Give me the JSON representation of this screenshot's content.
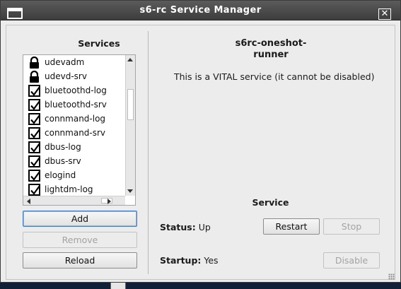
{
  "window": {
    "title": "s6-rc Service Manager",
    "close_glyph": "✕"
  },
  "services_panel": {
    "title": "Services",
    "items": [
      {
        "label": "udevadm",
        "icon": "lock-icon",
        "state": "locked"
      },
      {
        "label": "udevd-srv",
        "icon": "lock-icon",
        "state": "locked"
      },
      {
        "label": "bluetoothd-log",
        "icon": "checkbox-checked-icon",
        "state": "checked"
      },
      {
        "label": "bluetoothd-srv",
        "icon": "checkbox-checked-icon",
        "state": "checked"
      },
      {
        "label": "connmand-log",
        "icon": "checkbox-checked-icon",
        "state": "checked"
      },
      {
        "label": "connmand-srv",
        "icon": "checkbox-checked-icon",
        "state": "checked"
      },
      {
        "label": "dbus-log",
        "icon": "checkbox-checked-icon",
        "state": "checked"
      },
      {
        "label": "dbus-srv",
        "icon": "checkbox-checked-icon",
        "state": "checked"
      },
      {
        "label": "elogind",
        "icon": "checkbox-checked-icon",
        "state": "checked"
      },
      {
        "label": "lightdm-log",
        "icon": "checkbox-checked-icon",
        "state": "checked"
      }
    ],
    "add_label": "Add",
    "remove_label": "Remove",
    "reload_label": "Reload"
  },
  "detail": {
    "service_name": "s6rc-oneshot-\nrunner",
    "vital_notice": "This is a VITAL service (it cannot be disabled)",
    "section_title": "Service",
    "status_label": "Status:",
    "status_value": "Up",
    "startup_label": "Startup:",
    "startup_value": "Yes",
    "restart_label": "Restart",
    "stop_label": "Stop",
    "disable_label": "Disable"
  },
  "colors": {
    "titlebar": "#4a4a4a",
    "window_bg": "#ececec",
    "desktop_bg": "#1f3c63",
    "focus_accent": "#4a7fc0"
  }
}
